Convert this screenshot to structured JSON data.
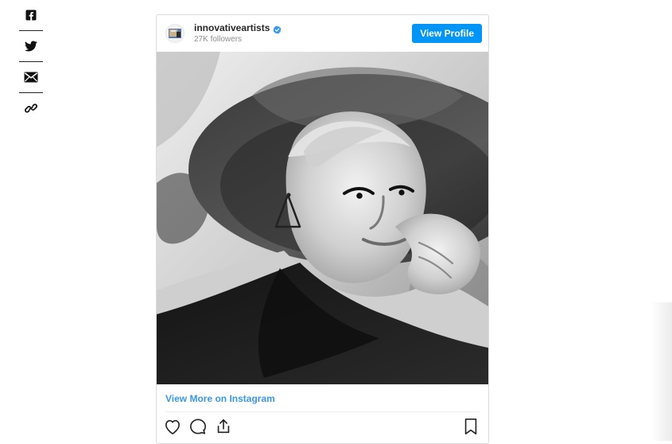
{
  "share": {
    "items": [
      {
        "icon": "facebook-icon"
      },
      {
        "icon": "twitter-icon"
      },
      {
        "icon": "email-icon"
      },
      {
        "icon": "link-icon"
      }
    ]
  },
  "instagram": {
    "username": "innovativeartists",
    "followers_text": "27K followers",
    "verified_icon": "verified-badge-icon",
    "view_profile_label": "View Profile",
    "view_more_label": "View More on Instagram",
    "accent_color": "#0095f6",
    "link_color": "#3897f0",
    "action_icons": [
      "heart-icon",
      "comment-icon",
      "share-upload-icon",
      "bookmark-icon"
    ]
  }
}
